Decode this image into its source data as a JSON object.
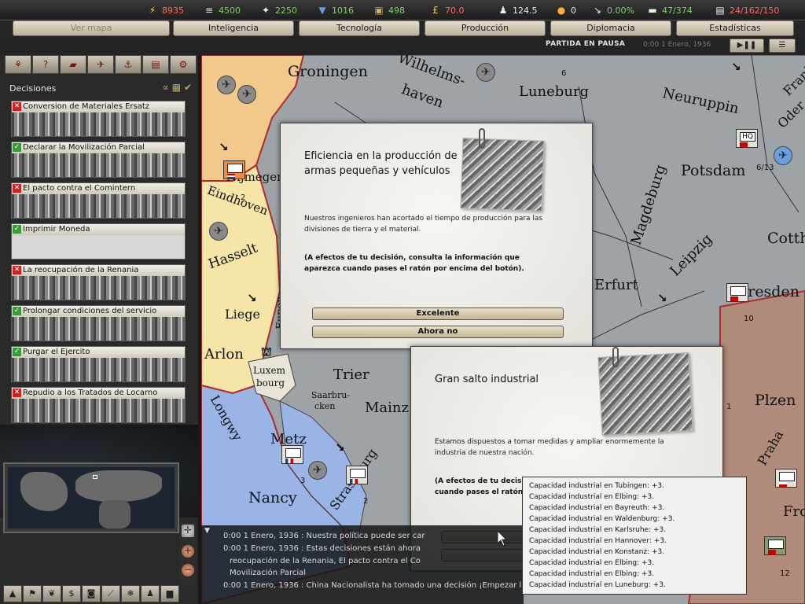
{
  "resources": [
    {
      "icon": "energy-icon",
      "glyph": "⚡",
      "value": "8935",
      "color": "red"
    },
    {
      "icon": "metal-icon",
      "glyph": "≡",
      "value": "4500",
      "color": "green"
    },
    {
      "icon": "rare-materials-icon",
      "glyph": "✦",
      "value": "2250",
      "color": "green"
    },
    {
      "icon": "oil-icon",
      "glyph": "💧",
      "value": "1016",
      "color": "green"
    },
    {
      "icon": "supplies-icon",
      "glyph": "▣",
      "value": "498",
      "color": "green"
    },
    {
      "icon": "money-icon",
      "glyph": "£",
      "value": "70.0",
      "color": "red"
    },
    {
      "icon": "manpower-icon",
      "glyph": "♟",
      "value": "124.5",
      "color": "white"
    },
    {
      "icon": "nuke-icon",
      "glyph": "●",
      "value": "0",
      "color": "white"
    },
    {
      "icon": "dissent-icon",
      "glyph": "↘",
      "value": "0.00%",
      "color": "green"
    },
    {
      "icon": "transport-icon",
      "glyph": "▬",
      "value": "47/374",
      "color": "green"
    },
    {
      "icon": "convoy-icon",
      "glyph": "▤",
      "value": "24/162/150",
      "color": "red"
    }
  ],
  "tabs": [
    "Ver mapa",
    "Inteligencia",
    "Tecnología",
    "Producción",
    "Diplomacia",
    "Estadísticas"
  ],
  "status": {
    "paused": "PARTIDA EN PAUSA",
    "date": "0:00 1 Enero, 1936"
  },
  "decisions_header": "Decisiones",
  "decisions": [
    {
      "label": "Conversion de Materiales Ersatz",
      "available": false
    },
    {
      "label": "Declarar la Movilización Parcial",
      "available": true
    },
    {
      "label": "El pacto contra el Comintern",
      "available": false
    },
    {
      "label": "Imprimir Moneda",
      "available": true
    },
    {
      "label": "La reocupación de la Renania",
      "available": false
    },
    {
      "label": "Prolongar condiciones del servicio",
      "available": true
    },
    {
      "label": "Purgar el Ejercito",
      "available": true
    },
    {
      "label": "Repudio a los Tratados de Locarno",
      "available": false
    }
  ],
  "map": {
    "cities": [
      "Groningen",
      "Wilhelms-",
      "haven",
      "Luneburg",
      "Neuruppin",
      "Potsdam",
      "Magdeburg",
      "Cotth",
      "Leipzig",
      "Erfurt",
      "Dresden",
      "Nijmegen",
      "Eindhoven",
      "Hasselt",
      "Liege",
      "Arlon",
      "Luxem",
      "bourg",
      "Trier",
      "Saarbru-",
      "cken",
      "Mainz",
      "Metz",
      "Nancy",
      "Strasbourg",
      "Plzen",
      "Praha",
      "Fro",
      "Longwy",
      "Eupen",
      "Frank",
      "Oder"
    ],
    "unit_labels": [
      "HQ",
      "6/13",
      "2",
      "10",
      "3",
      "2",
      "1",
      "12",
      "6"
    ]
  },
  "popup1": {
    "title": "Eficiencia en la producción de armas pequeñas y vehículos",
    "description": "Nuestros ingenieros han acortado el tiempo de producción para las divisiones de tierra y el material.",
    "note": "(A efectos de tu decisión, consulta la información que aparezca cuando pases el ratón por encima del botón).",
    "accept": "Excelente",
    "later": "Ahora no"
  },
  "popup2": {
    "title": "Gran salto industrial",
    "description": "Estamos dispuestos a tomar medidas y ampliar enormemente la industria de nuestra nación.",
    "note_line1": "(A efectos de tu decisió",
    "note_line2": "cuando pases el ratón p"
  },
  "tooltip": [
    "Capacidad industrial en Tubingen: +3.",
    "Capacidad industrial en Elbing: +3.",
    "Capacidad industrial en Bayreuth: +3.",
    "Capacidad industrial en Waldenburg: +3.",
    "Capacidad industrial en Karlsruhe: +3.",
    "Capacidad industrial en Hannover: +3.",
    "Capacidad industrial en Konstanz: +3.",
    "Capacidad industrial en Elbing: +3.",
    "Capacidad industrial en Elbing: +3.",
    "Capacidad industrial en Luneburg: +3."
  ],
  "log": [
    "0:00 1 Enero, 1936 : Nuestra política puede ser car",
    "0:00 1 Enero, 1936 : Estas decisiones están ahora",
    "reocupación de la Renania, El pacto contra el Co",
    "Movilización Parcial",
    "0:00 1 Enero, 1936 : China Nacionalista ha tomado una decisión ¡Empezar la moc"
  ],
  "colors": {
    "accent": "#7dcf6a",
    "warning": "#ff6a5a",
    "germany": "#a8adb3",
    "france": "#9ab4e6",
    "netherlands": "#f2c98a",
    "belgium": "#f5e6a8"
  }
}
